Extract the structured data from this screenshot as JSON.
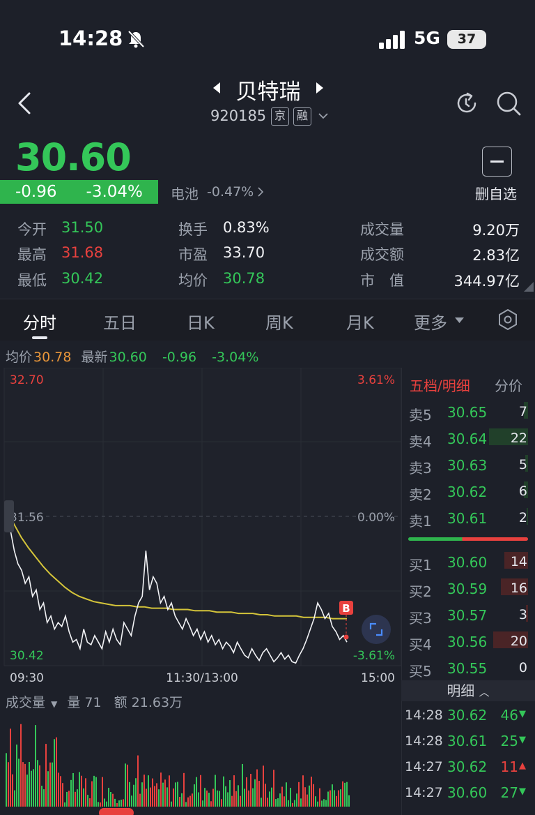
{
  "status_bar": {
    "time": "14:28",
    "network": "5G",
    "battery": "37"
  },
  "header": {
    "stock_name": "贝特瑞",
    "stock_code": "920185",
    "tag_1": "京",
    "tag_2": "融"
  },
  "quote": {
    "last_price": "30.60",
    "change_abs": "-0.96",
    "change_pct": "-3.04%",
    "sector_name": "电池",
    "sector_pct": "-0.47%",
    "remove_watch_label": "删自选",
    "stats": [
      {
        "label": "今开",
        "value": "31.50",
        "color": "green"
      },
      {
        "label": "最高",
        "value": "31.68",
        "color": "red"
      },
      {
        "label": "最低",
        "value": "30.42",
        "color": "green"
      },
      {
        "label": "换手",
        "value": "0.83%",
        "color": "white"
      },
      {
        "label": "市盈",
        "value": "33.70",
        "color": "white"
      },
      {
        "label": "均价",
        "value": "30.78",
        "color": "green"
      },
      {
        "label": "成交量",
        "value": "9.20万",
        "color": "white"
      },
      {
        "label": "成交额",
        "value": "2.83亿",
        "color": "white"
      },
      {
        "label": "市　值",
        "value": "344.97亿",
        "color": "white"
      }
    ]
  },
  "tabs": [
    "分时",
    "五日",
    "日K",
    "周K",
    "月K",
    "更多"
  ],
  "active_tab": "分时",
  "info_line": {
    "avg_label": "均价",
    "avg_value": "30.78",
    "latest_label": "最新",
    "latest_value": "30.60",
    "change_abs": "-0.96",
    "change_pct": "-3.04%"
  },
  "chart_data": {
    "type": "line",
    "y_top": "32.70",
    "y_mid": "31.56",
    "y_bottom": "30.42",
    "pct_top": "3.61%",
    "pct_mid": "0.00%",
    "pct_bottom": "-3.61%",
    "x_labels": [
      "09:30",
      "11:30/13:00",
      "15:00"
    ],
    "ylim": [
      30.42,
      32.7
    ],
    "marker": "B",
    "series": [
      {
        "name": "price",
        "values": [
          31.6,
          31.45,
          31.3,
          31.2,
          31.15,
          31.05,
          31.1,
          30.95,
          31.0,
          30.85,
          30.9,
          30.75,
          30.8,
          30.7,
          30.75,
          30.72,
          30.8,
          30.68,
          30.6,
          30.62,
          30.55,
          30.7,
          30.6,
          30.58,
          30.65,
          30.6,
          30.55,
          30.68,
          30.6,
          30.7,
          30.62,
          30.58,
          30.75,
          30.7,
          30.65,
          30.8,
          30.9,
          30.95,
          31.3,
          31.0,
          31.1,
          31.05,
          30.9,
          30.95,
          30.85,
          30.9,
          30.8,
          30.75,
          30.7,
          30.78,
          30.72,
          30.65,
          30.7,
          30.62,
          30.68,
          30.6,
          30.65,
          30.58,
          30.62,
          30.55,
          30.6,
          30.57,
          30.52,
          30.6,
          30.55,
          30.5,
          30.48,
          30.55,
          30.5,
          30.46,
          30.52,
          30.55,
          30.5,
          30.45,
          30.48,
          30.52,
          30.47,
          30.5,
          30.45,
          30.44,
          30.5,
          30.55,
          30.62,
          30.7,
          30.78,
          30.9,
          30.85,
          30.78,
          30.82,
          30.72,
          30.68,
          30.62,
          30.65,
          30.6
        ]
      },
      {
        "name": "average",
        "values": [
          31.6,
          31.5,
          31.4,
          31.32,
          31.25,
          31.18,
          31.12,
          31.07,
          31.02,
          30.98,
          30.95,
          30.93,
          30.91,
          30.9,
          30.89,
          30.88,
          30.88,
          30.88,
          30.87,
          30.87,
          30.86,
          30.86,
          30.86,
          30.85,
          30.85,
          30.85,
          30.84,
          30.84,
          30.84,
          30.83,
          30.83,
          30.83,
          30.82,
          30.82,
          30.82,
          30.81,
          30.81,
          30.8,
          30.8,
          30.8,
          30.8,
          30.79,
          30.79,
          30.79,
          30.79,
          30.78,
          30.78,
          30.78
        ]
      }
    ]
  },
  "volume": {
    "label": "成交量",
    "vol_text": "量 71",
    "amount_text": "额 21.63万"
  },
  "order_book": {
    "title": "五档/明细",
    "fenjia": "分价",
    "sells": [
      {
        "label": "卖5",
        "price": "30.65",
        "vol": "7",
        "bar": 0.1
      },
      {
        "label": "卖4",
        "price": "30.64",
        "vol": "22",
        "bar": 1.0
      },
      {
        "label": "卖3",
        "price": "30.63",
        "vol": "5",
        "bar": 0.08
      },
      {
        "label": "卖2",
        "price": "30.62",
        "vol": "6",
        "bar": 0.1
      },
      {
        "label": "卖1",
        "price": "30.61",
        "vol": "2",
        "bar": 0.03
      }
    ],
    "buys": [
      {
        "label": "买1",
        "price": "30.60",
        "vol": "14",
        "bar": 0.6
      },
      {
        "label": "买2",
        "price": "30.59",
        "vol": "16",
        "bar": 0.7
      },
      {
        "label": "买3",
        "price": "30.57",
        "vol": "3",
        "bar": 0.06
      },
      {
        "label": "买4",
        "price": "30.56",
        "vol": "20",
        "bar": 0.9
      },
      {
        "label": "买5",
        "price": "30.55",
        "vol": "0",
        "bar": 0
      }
    ],
    "detail_label": "明细",
    "trades": [
      {
        "time": "14:28",
        "price": "30.62",
        "vol": "46",
        "dir": "down",
        "color": "green"
      },
      {
        "time": "14:28",
        "price": "30.61",
        "vol": "25",
        "dir": "down",
        "color": "green"
      },
      {
        "time": "14:27",
        "price": "30.62",
        "vol": "11",
        "dir": "up",
        "color": "red"
      },
      {
        "time": "14:27",
        "price": "30.60",
        "vol": "27",
        "dir": "down",
        "color": "green"
      }
    ]
  },
  "colors": {
    "up": "#e8413e",
    "down": "#34c759",
    "avg_line": "#d4c43a",
    "price_line": "#f1f2f5",
    "accent_orange": "#e9963a"
  }
}
